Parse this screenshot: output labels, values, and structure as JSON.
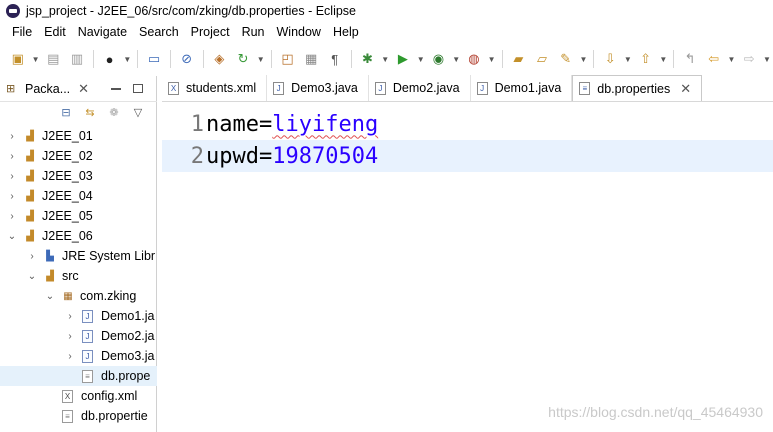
{
  "window": {
    "title": "jsp_project - J2EE_06/src/com/zking/db.properties - Eclipse"
  },
  "menu": [
    "File",
    "Edit",
    "Navigate",
    "Search",
    "Project",
    "Run",
    "Window",
    "Help"
  ],
  "package_explorer": {
    "tab_label": "Packa...",
    "tree": [
      {
        "label": "J2EE_01",
        "level": 0,
        "twisty": "closed",
        "icon": "project"
      },
      {
        "label": "J2EE_02",
        "level": 0,
        "twisty": "closed",
        "icon": "project"
      },
      {
        "label": "J2EE_03",
        "level": 0,
        "twisty": "closed",
        "icon": "project"
      },
      {
        "label": "J2EE_04",
        "level": 0,
        "twisty": "closed",
        "icon": "project"
      },
      {
        "label": "J2EE_05",
        "level": 0,
        "twisty": "closed",
        "icon": "project"
      },
      {
        "label": "J2EE_06",
        "level": 0,
        "twisty": "open",
        "icon": "project"
      },
      {
        "label": "JRE System Libr",
        "level": 1,
        "twisty": "closed",
        "icon": "jre"
      },
      {
        "label": "src",
        "level": 1,
        "twisty": "open",
        "icon": "srcfolder"
      },
      {
        "label": "com.zking",
        "level": 2,
        "twisty": "open",
        "icon": "package"
      },
      {
        "label": "Demo1.ja",
        "level": 3,
        "twisty": "closed",
        "icon": "java"
      },
      {
        "label": "Demo2.ja",
        "level": 3,
        "twisty": "closed",
        "icon": "java"
      },
      {
        "label": "Demo3.ja",
        "level": 3,
        "twisty": "closed",
        "icon": "java"
      },
      {
        "label": "db.prope",
        "level": 3,
        "twisty": "none",
        "icon": "file",
        "selected": true
      },
      {
        "label": "config.xml",
        "level": 2,
        "twisty": "none",
        "icon": "xml"
      },
      {
        "label": "db.propertie",
        "level": 2,
        "twisty": "none",
        "icon": "file"
      }
    ]
  },
  "editor": {
    "tabs": [
      {
        "label": "students.xml",
        "icon": "xml"
      },
      {
        "label": "Demo3.java",
        "icon": "java"
      },
      {
        "label": "Demo2.java",
        "icon": "java"
      },
      {
        "label": "Demo1.java",
        "icon": "java"
      },
      {
        "label": "db.properties",
        "icon": "file",
        "active": true
      }
    ],
    "lines": [
      {
        "num": "1",
        "key": "name",
        "eq": "=",
        "value": "liyifeng",
        "squiggle": true
      },
      {
        "num": "2",
        "key": "upwd",
        "eq": "=",
        "value": "19870504",
        "current": true
      }
    ]
  },
  "watermark": "https://blog.csdn.net/qq_45464930",
  "colors": {
    "value_blue": "#2a00ff",
    "current_line": "#e8f2fe",
    "selection": "#e5f1fb"
  }
}
